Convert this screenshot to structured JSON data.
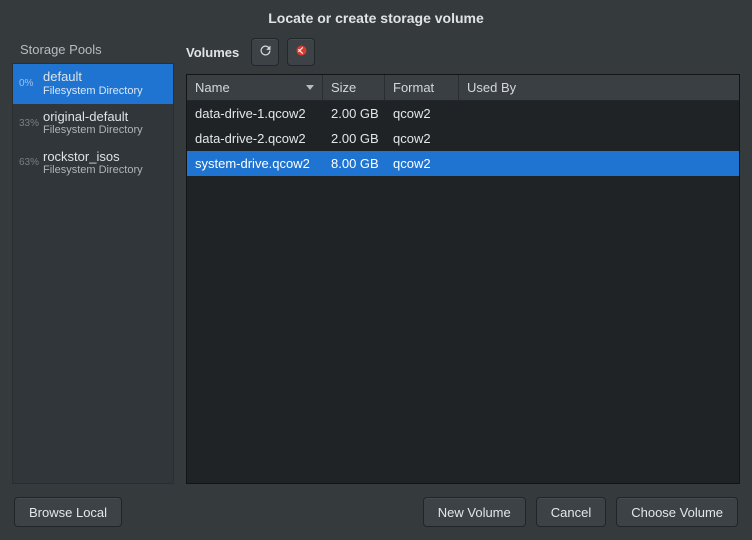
{
  "title": "Locate or create storage volume",
  "sidebar": {
    "header": "Storage Pools",
    "pools": [
      {
        "name": "default",
        "sub": "Filesystem Directory",
        "pct": "0%",
        "selected": true
      },
      {
        "name": "original-default",
        "sub": "Filesystem Directory",
        "pct": "33%",
        "selected": false
      },
      {
        "name": "rockstor_isos",
        "sub": "Filesystem Directory",
        "pct": "63%",
        "selected": false
      }
    ]
  },
  "toolbar": {
    "volumes_label": "Volumes"
  },
  "table": {
    "headers": {
      "name": "Name",
      "size": "Size",
      "format": "Format",
      "usedby": "Used By"
    },
    "rows": [
      {
        "name": "data-drive-1.qcow2",
        "size": "2.00 GB",
        "format": "qcow2",
        "usedby": "",
        "selected": false
      },
      {
        "name": "data-drive-2.qcow2",
        "size": "2.00 GB",
        "format": "qcow2",
        "usedby": "",
        "selected": false
      },
      {
        "name": "system-drive.qcow2",
        "size": "8.00 GB",
        "format": "qcow2",
        "usedby": "",
        "selected": true
      }
    ]
  },
  "buttons": {
    "browse_local": "Browse Local",
    "new_volume": "New Volume",
    "cancel": "Cancel",
    "choose_volume": "Choose Volume"
  }
}
